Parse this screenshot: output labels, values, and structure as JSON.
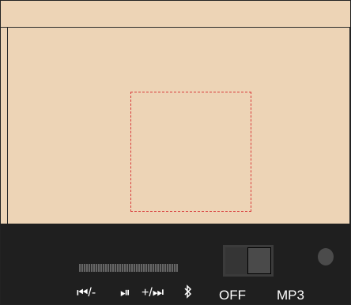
{
  "controls": {
    "prev_label": "⏮/-",
    "play_label": "⏯",
    "next_label": "+/⏭",
    "bluetooth_icon": "bluetooth-icon",
    "power_state": "OFF",
    "mode": "MP3"
  },
  "colors": {
    "panel": "#edd4b6",
    "control_bar": "#1f1f1f",
    "drop_outline": "#d93a3a"
  }
}
